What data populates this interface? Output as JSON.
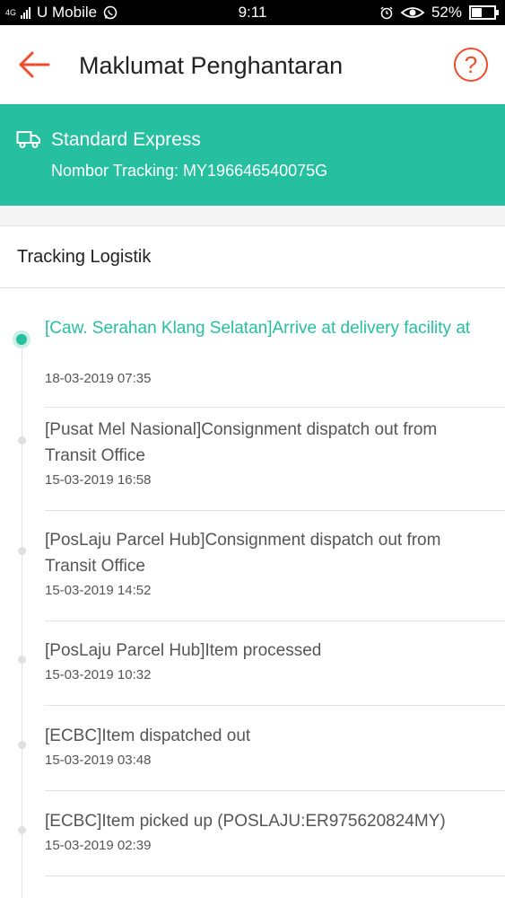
{
  "status_bar": {
    "network": "4G",
    "carrier": "U Mobile",
    "time": "9:11",
    "battery": "52%",
    "battery_level": 0.52,
    "icons": [
      "signal-icon",
      "whatsapp-icon",
      "alarm-icon",
      "eye-icon",
      "battery-icon"
    ]
  },
  "header": {
    "title": "Maklumat Penghantaran",
    "help_glyph": "?"
  },
  "shipping": {
    "method": "Standard Express",
    "tracking_label": "Nombor Tracking: MY196646540075G"
  },
  "section": {
    "title": "Tracking Logistik"
  },
  "events": [
    {
      "description": "[Caw. Serahan Klang Selatan]Arrive at delivery facility at",
      "time": "18-03-2019 07:35",
      "active": true
    },
    {
      "description": "[Pusat Mel Nasional]Consignment dispatch out from Transit Office",
      "time": "15-03-2019 16:58",
      "active": false
    },
    {
      "description": "[PosLaju Parcel Hub]Consignment dispatch out from Transit Office",
      "time": "15-03-2019 14:52",
      "active": false
    },
    {
      "description": "[PosLaju Parcel Hub]Item processed",
      "time": "15-03-2019 10:32",
      "active": false
    },
    {
      "description": "[ECBC]Item dispatched out",
      "time": "15-03-2019 03:48",
      "active": false
    },
    {
      "description": "[ECBC]Item picked up (POSLAJU:ER975620824MY)",
      "time": "15-03-2019 02:39",
      "active": false
    }
  ],
  "colors": {
    "accent": "#ee4d2d",
    "teal": "#26bfa0"
  }
}
